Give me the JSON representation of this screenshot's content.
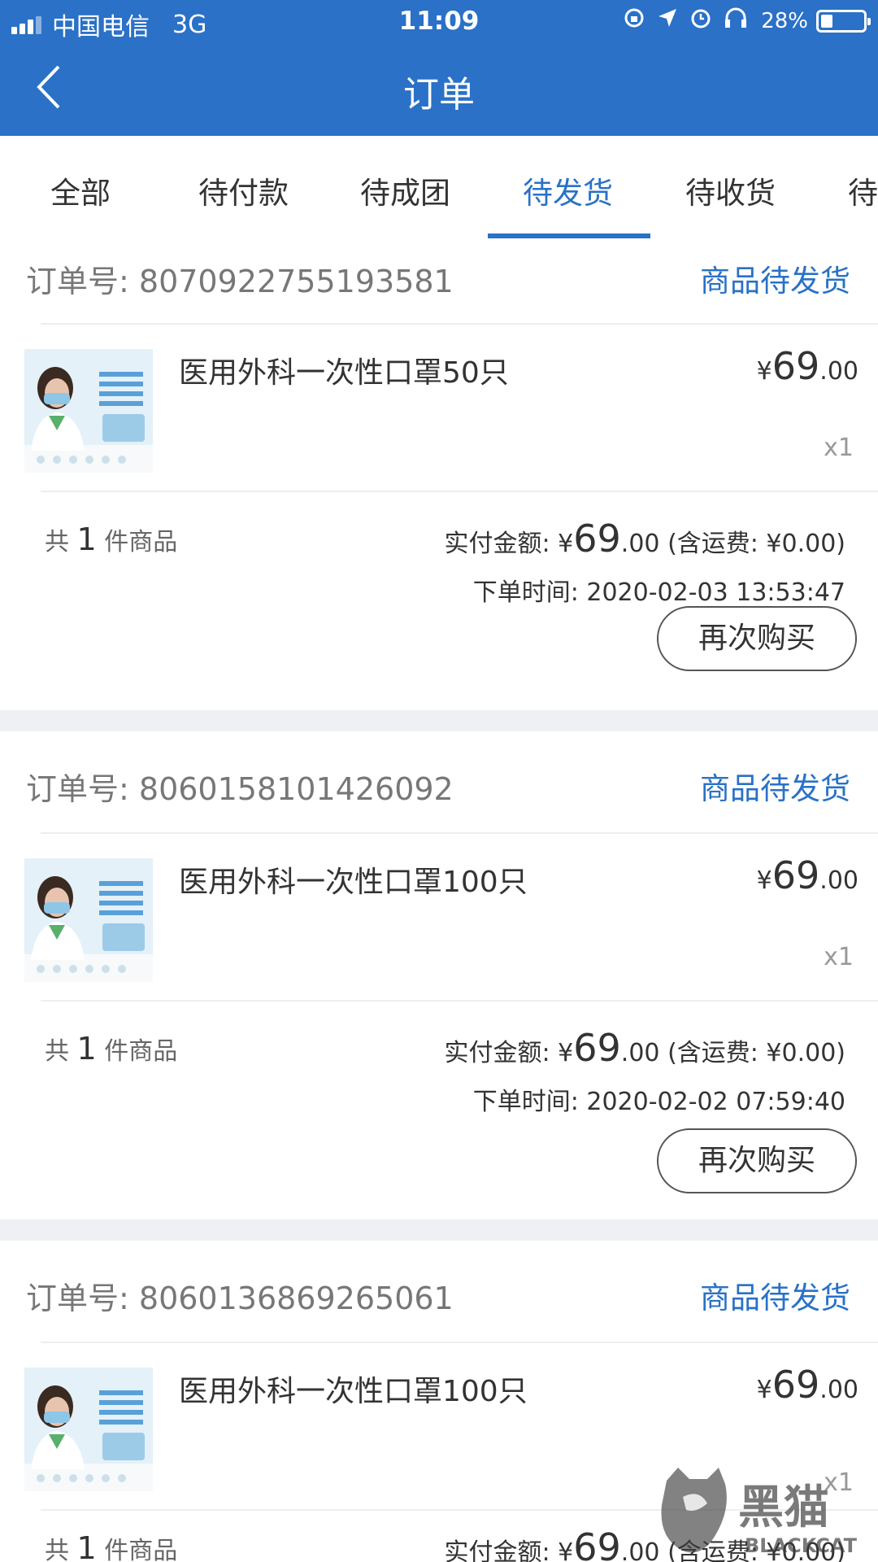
{
  "status_bar": {
    "carrier": "中国电信",
    "network": "3G",
    "time": "11:09",
    "battery": "28%",
    "battery_level": 0.28,
    "icons": [
      "rotation-lock-icon",
      "location-icon",
      "alarm-icon",
      "headphones-icon"
    ]
  },
  "header": {
    "title": "订单",
    "back_icon": "chevron-left-icon"
  },
  "tabs": [
    {
      "label": "全部",
      "active": false
    },
    {
      "label": "待付款",
      "active": false
    },
    {
      "label": "待成团",
      "active": false
    },
    {
      "label": "待发货",
      "active": true
    },
    {
      "label": "待收货",
      "active": false
    },
    {
      "label": "待",
      "active": false
    }
  ],
  "orders": [
    {
      "order_no_label": "订单号: ",
      "order_no": "8070922755193581",
      "status": "商品待发货",
      "item_name": "医用外科一次性口罩50只",
      "price_symbol": "¥",
      "price_int": "69",
      "price_dec": ".00",
      "qty": "x1",
      "count_prefix": "共",
      "count_num": "1",
      "count_suffix": "件商品",
      "paid_label": "实付金额: ¥",
      "paid_int": "69",
      "paid_dec": ".00",
      "shipping": "(含运费: ¥0.00)",
      "time_label": "下单时间: ",
      "time": "2020-02-03 13:53:47",
      "rebuy_label": "再次购买"
    },
    {
      "order_no_label": "订单号: ",
      "order_no": "8060158101426092",
      "status": "商品待发货",
      "item_name": "医用外科一次性口罩100只",
      "price_symbol": "¥",
      "price_int": "69",
      "price_dec": ".00",
      "qty": "x1",
      "count_prefix": "共",
      "count_num": "1",
      "count_suffix": "件商品",
      "paid_label": "实付金额: ¥",
      "paid_int": "69",
      "paid_dec": ".00",
      "shipping": "(含运费: ¥0.00)",
      "time_label": "下单时间: ",
      "time": "2020-02-02 07:59:40",
      "rebuy_label": "再次购买"
    },
    {
      "order_no_label": "订单号: ",
      "order_no": "8060136869265061",
      "status": "商品待发货",
      "item_name": "医用外科一次性口罩100只",
      "price_symbol": "¥",
      "price_int": "69",
      "price_dec": ".00",
      "qty": "x1",
      "count_prefix": "共",
      "count_num": "1",
      "count_suffix": "件商品",
      "paid_label": "实付金额: ¥",
      "paid_int": "69",
      "paid_dec": ".00",
      "shipping": "(含运费: ¥0.00)"
    }
  ],
  "watermark": {
    "text": "黑猫",
    "subtext": "BLACKCAT"
  },
  "colors": {
    "accent": "#2a71c7",
    "divider": "#eeeeee",
    "gap": "#eef0f3"
  }
}
